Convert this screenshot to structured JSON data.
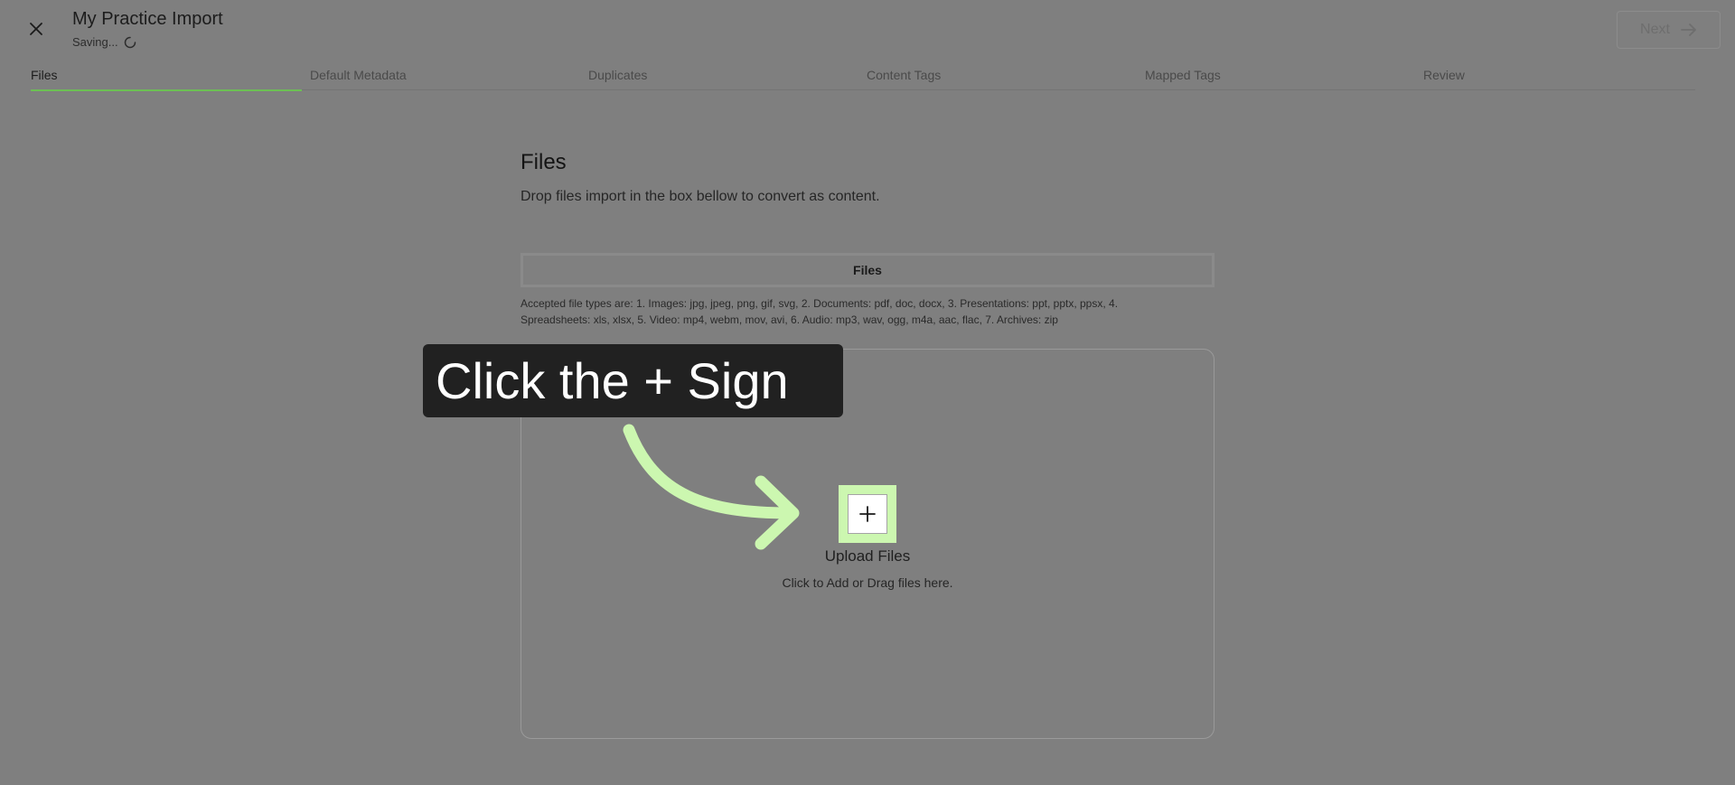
{
  "header": {
    "title": "My Practice Import",
    "status": "Saving...",
    "next_label": "Next"
  },
  "tabs": [
    {
      "label": "Files",
      "active": true
    },
    {
      "label": "Default Metadata",
      "active": false
    },
    {
      "label": "Duplicates",
      "active": false
    },
    {
      "label": "Content Tags",
      "active": false
    },
    {
      "label": "Mapped Tags",
      "active": false
    },
    {
      "label": "Review",
      "active": false
    }
  ],
  "main": {
    "section_title": "Files",
    "description": "Drop files import in the box bellow to convert as content.",
    "files_toggle_label": "Files",
    "accepted_types": "Accepted file types are: 1. Images: jpg, jpeg, png, gif, svg, 2. Documents: pdf, doc, docx, 3. Presentations: ppt, pptx, ppsx, 4. Spreadsheets: xls, xlsx, 5. Video: mp4, webm, mov, avi, 6. Audio: mp3, wav, ogg, m4a, aac, flac, 7. Archives: zip",
    "upload_title": "Upload Files",
    "upload_subtitle": "Click to Add or Drag files here."
  },
  "callout": {
    "text": "Click the + Sign",
    "arrow_color": "#ccf7b0",
    "background": "#212121"
  },
  "icons": {
    "close": "close-icon",
    "spinner": "spinner-icon",
    "next": "arrow-right-icon",
    "add": "plus-icon"
  },
  "colors": {
    "overlay": "#7f7f7f",
    "active_tab_underline": "#6cbf54",
    "highlight": "#ccf7b0"
  }
}
